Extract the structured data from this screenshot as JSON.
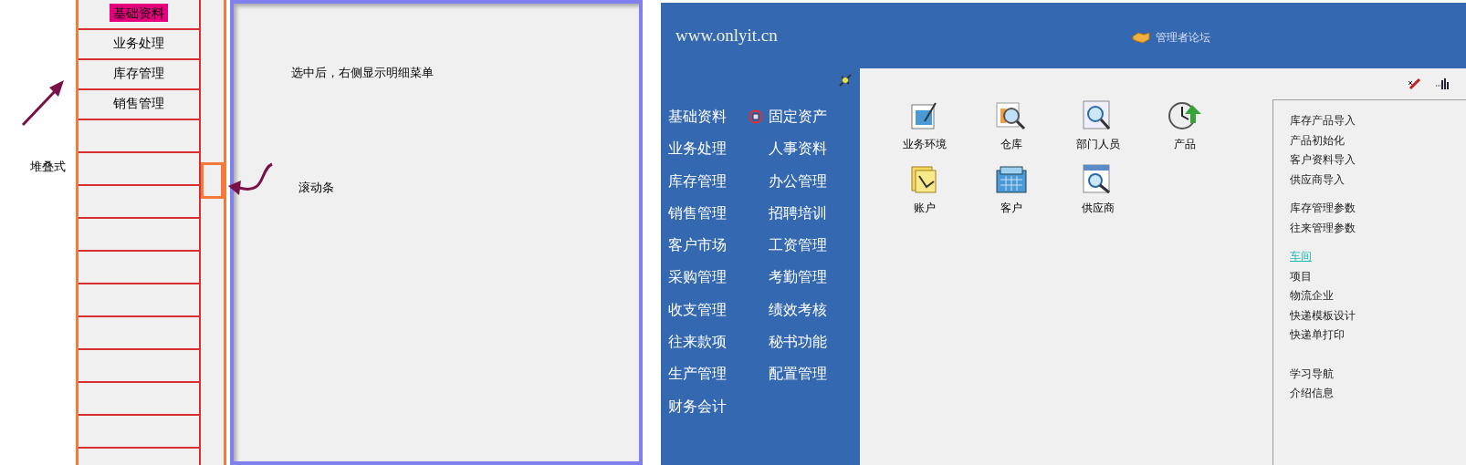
{
  "sketch": {
    "stack_label": "堆叠式",
    "menu_items": [
      {
        "label": "基础资料",
        "selected": true
      },
      {
        "label": "业务处理",
        "selected": false
      },
      {
        "label": "库存管理",
        "selected": false
      },
      {
        "label": "销售管理",
        "selected": false
      }
    ],
    "note": "选中后，右侧显示明细菜单",
    "scrollbar_label": "滚动条"
  },
  "app": {
    "site": "www.onlyit.cn",
    "forum_link": "管理者论坛",
    "menu_left": [
      "基础资料",
      "业务处理",
      "库存管理",
      "销售管理",
      "客户市场",
      "采购管理",
      "收支管理",
      "往来款项",
      "生产管理",
      "财务会计"
    ],
    "menu_right": [
      {
        "label": "固定资产",
        "icon": true
      },
      {
        "label": "人事资料",
        "icon": false
      },
      {
        "label": "办公管理",
        "icon": false
      },
      {
        "label": "招聘培训",
        "icon": false
      },
      {
        "label": "工资管理",
        "icon": false
      },
      {
        "label": "考勤管理",
        "icon": false
      },
      {
        "label": "绩效考核",
        "icon": false
      },
      {
        "label": "秘书功能",
        "icon": false
      },
      {
        "label": "配置管理",
        "icon": false
      }
    ],
    "shortcuts": [
      {
        "label": "业务环境",
        "kind": "environment"
      },
      {
        "label": "仓库",
        "kind": "warehouse"
      },
      {
        "label": "部门人员",
        "kind": "people"
      },
      {
        "label": "产品",
        "kind": "product"
      },
      {
        "label": "账户",
        "kind": "account"
      },
      {
        "label": "客户",
        "kind": "customer"
      },
      {
        "label": "供应商",
        "kind": "supplier"
      }
    ],
    "link_groups": [
      [
        {
          "label": "库存产品导入",
          "active": false
        },
        {
          "label": "产品初始化",
          "active": false
        },
        {
          "label": "客户资料导入",
          "active": false
        },
        {
          "label": "供应商导入",
          "active": false
        }
      ],
      [
        {
          "label": "库存管理参数",
          "active": false
        },
        {
          "label": "往来管理参数",
          "active": false
        }
      ],
      [
        {
          "label": "车间",
          "active": true
        },
        {
          "label": "项目",
          "active": false
        },
        {
          "label": "物流企业",
          "active": false
        },
        {
          "label": "快递模板设计",
          "active": false
        },
        {
          "label": "快递单打印",
          "active": false
        }
      ],
      [
        {
          "label": "学习导航",
          "active": false
        },
        {
          "label": "介绍信息",
          "active": false
        }
      ]
    ]
  }
}
